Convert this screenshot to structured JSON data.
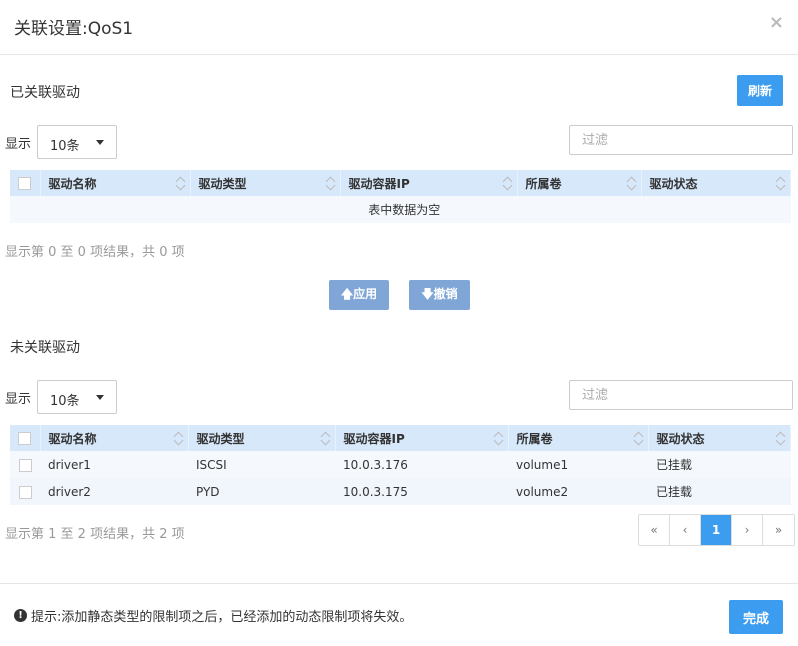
{
  "modal": {
    "title": "关联设置:QoS1",
    "close_glyph": "×"
  },
  "associated": {
    "title": "已关联驱动",
    "refresh_label": "刷新",
    "show_label": "显示",
    "page_size": "10条",
    "filter_placeholder": "过滤",
    "columns": [
      "驱动名称",
      "驱动类型",
      "驱动容器IP",
      "所属卷",
      "驱动状态"
    ],
    "empty_text": "表中数据为空",
    "info": "显示第 0 至 0 项结果，共 0 项"
  },
  "actions": {
    "apply_label": "应用",
    "revoke_label": "撤销"
  },
  "unassociated": {
    "title": "未关联驱动",
    "show_label": "显示",
    "page_size": "10条",
    "filter_placeholder": "过滤",
    "columns": [
      "驱动名称",
      "驱动类型",
      "驱动容器IP",
      "所属卷",
      "驱动状态"
    ],
    "rows": [
      {
        "name": "driver1",
        "type": "ISCSI",
        "ip": "10.0.3.176",
        "volume": "volume1",
        "status": "已挂载"
      },
      {
        "name": "driver2",
        "type": "PYD",
        "ip": "10.0.3.175",
        "volume": "volume2",
        "status": "已挂载"
      }
    ],
    "info": "显示第 1 至 2 项结果，共 2 项",
    "pagination": {
      "first": "«",
      "prev": "‹",
      "current": "1",
      "next": "›",
      "last": "»"
    }
  },
  "footer": {
    "tip_icon": "!",
    "tip": "提示:添加静态类型的限制项之后，已经添加的动态限制项将失效。",
    "done_label": "完成"
  },
  "colors": {
    "primary": "#3c9cf0",
    "muted_button": "#7fa6d6",
    "header_row": "#d7e8fb",
    "status_ok": "#2e9a48"
  }
}
